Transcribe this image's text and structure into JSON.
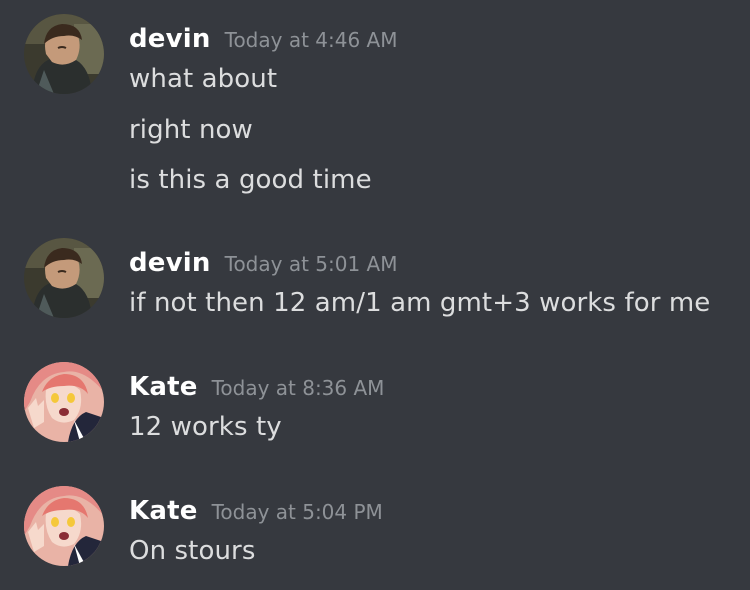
{
  "messages": [
    {
      "author": "devin",
      "timestamp": "Today at 4:46 AM",
      "avatar_icon": "man-in-hood-avatar",
      "lines": [
        "what about",
        "right now",
        "is this a good time"
      ]
    },
    {
      "author": "devin",
      "timestamp": "Today at 5:01 AM",
      "avatar_icon": "man-in-hood-avatar",
      "lines": [
        "if not then 12 am/1 am gmt+3 works for me"
      ]
    },
    {
      "author": "Kate",
      "timestamp": "Today at 8:36 AM",
      "avatar_icon": "pink-hair-anime-girl-avatar",
      "lines": [
        "12 works ty"
      ]
    },
    {
      "author": "Kate",
      "timestamp": "Today at 5:04 PM",
      "avatar_icon": "pink-hair-anime-girl-avatar",
      "lines": [
        "On stours"
      ]
    }
  ],
  "colors": {
    "background": "#36393f",
    "username": "#ffffff",
    "timestamp": "#8e9297",
    "message_text": "#dcddde"
  }
}
